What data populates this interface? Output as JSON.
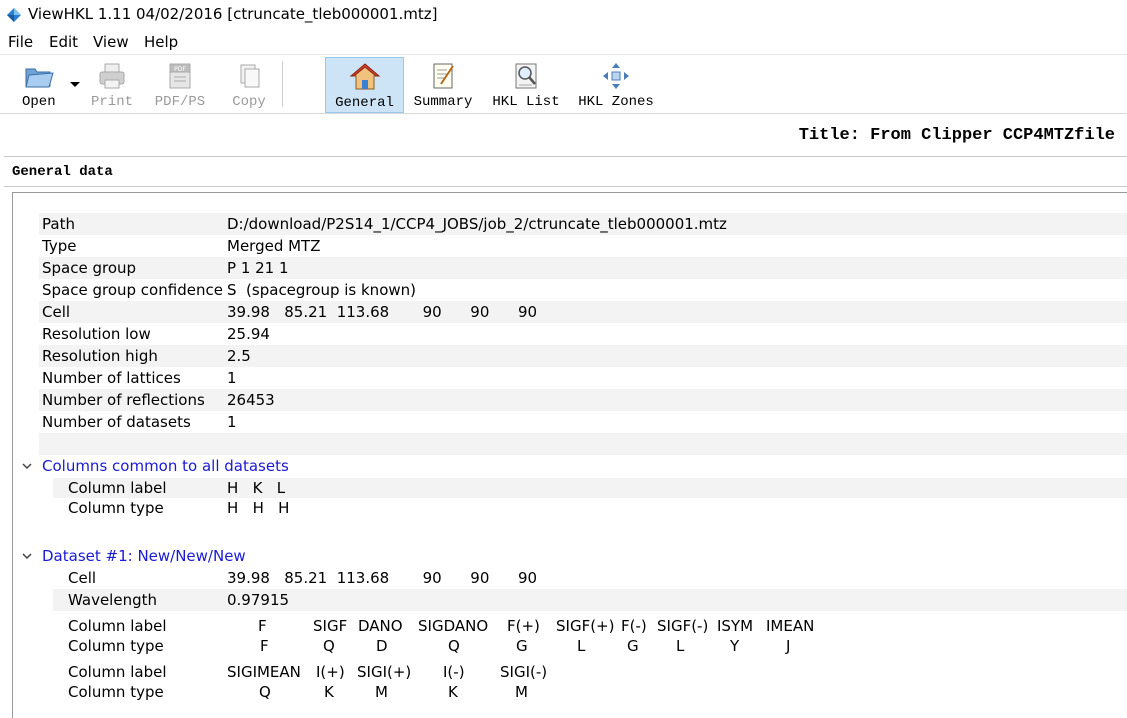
{
  "window": {
    "title": "ViewHKL 1.11 04/02/2016 [ctruncate_tleb000001.mtz]"
  },
  "menu": [
    "File",
    "Edit",
    "View",
    "Help"
  ],
  "toolbar": {
    "open": "Open",
    "print": "Print",
    "pdf": "PDF/PS",
    "copy": "Copy",
    "general": "General",
    "summary": "Summary",
    "hkl_list": "HKL List",
    "hkl_zones": "HKL Zones"
  },
  "doc_title": "Title: From Clipper CCP4MTZfile",
  "section": "General data",
  "general_rows": [
    {
      "key": "Path",
      "value": "D:/download/P2S14_1/CCP4_JOBS/job_2/ctruncate_tleb000001.mtz"
    },
    {
      "key": "Type",
      "value": "Merged MTZ"
    },
    {
      "key": "Space group",
      "value": "P 1 21 1"
    },
    {
      "key": "Space group confidence",
      "value": "S  (spacegroup is known)"
    },
    {
      "key": "Cell",
      "value": "39.98   85.21  113.68       90      90      90"
    },
    {
      "key": "Resolution low",
      "value": "25.94"
    },
    {
      "key": "Resolution high",
      "value": "2.5"
    },
    {
      "key": "Number of lattices",
      "value": "1"
    },
    {
      "key": "Number of reflections",
      "value": "26453"
    },
    {
      "key": "Number of datasets",
      "value": "1"
    }
  ],
  "common_group": {
    "title": "Columns common to all datasets",
    "label_key": "Column label",
    "label_value": "H   K   L",
    "type_key": "Column type",
    "type_value": "H   H   H"
  },
  "dataset_group": {
    "title": "Dataset #1: New/New/New",
    "cell_key": "Cell",
    "cell_value": "39.98   85.21  113.68       90      90      90",
    "wavelength_key": "Wavelength",
    "wavelength_value": "0.97915",
    "label_key": "Column label",
    "type_key": "Column type",
    "labels1": [
      "F",
      "SIGF",
      "DANO",
      "SIGDANO",
      "F(+)",
      "SIGF(+)",
      "F(-)",
      "SIGF(-)",
      "ISYM",
      "IMEAN"
    ],
    "types1": [
      "F",
      "Q",
      "D",
      "Q",
      "G",
      "L",
      "G",
      "L",
      "Y",
      "J"
    ],
    "labels2": [
      "SIGIMEAN",
      "I(+)",
      "SIGI(+)",
      "I(-)",
      "SIGI(-)"
    ],
    "types2": [
      "Q",
      "K",
      "M",
      "K",
      "M"
    ]
  },
  "colors": {
    "group_title": "#1a1ad6",
    "active_tool": "#cde4f7"
  },
  "icons": [
    "app-icon",
    "open-folder-icon",
    "printer-icon",
    "pdf-icon",
    "copy-icon",
    "home-icon",
    "notepad-icon",
    "magnifier-list-icon",
    "zones-arrows-icon",
    "chevron-down-icon"
  ]
}
